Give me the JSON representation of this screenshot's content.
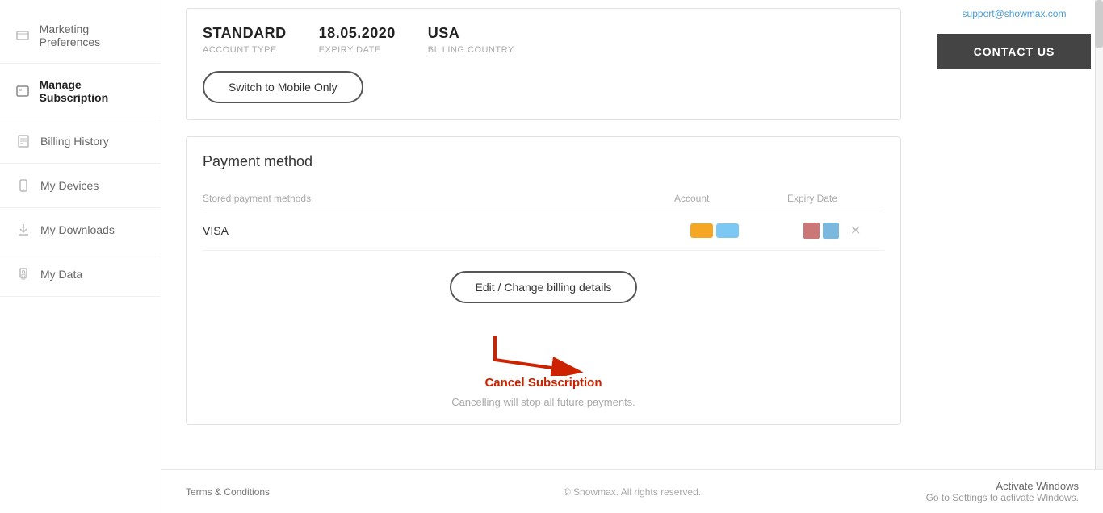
{
  "sidebar": {
    "items": [
      {
        "id": "marketing-preferences",
        "label": "Marketing Preferences",
        "icon": "☰",
        "active": false
      },
      {
        "id": "manage-subscription",
        "label": "Manage Subscription",
        "icon": "▭",
        "active": true
      },
      {
        "id": "billing-history",
        "label": "Billing History",
        "icon": "▦",
        "active": false
      },
      {
        "id": "my-devices",
        "label": "My Devices",
        "icon": "📱",
        "active": false
      },
      {
        "id": "my-downloads",
        "label": "My Downloads",
        "icon": "⬇",
        "active": false
      },
      {
        "id": "my-data",
        "label": "My Data",
        "icon": "🔒",
        "active": false
      }
    ]
  },
  "subscription": {
    "account_type": "STANDARD",
    "account_type_label": "ACCOUNT TYPE",
    "expiry_date": "18.05.2020",
    "expiry_date_label": "EXPIRY DATE",
    "billing_country": "USA",
    "billing_country_label": "BILLING COUNTRY",
    "switch_button_label": "Switch to Mobile Only"
  },
  "payment": {
    "section_title": "Payment method",
    "headers": {
      "col1": "Stored payment methods",
      "col2": "Account",
      "col3": "Expiry Date"
    },
    "rows": [
      {
        "method": "VISA",
        "account_color1": "#f5a623",
        "account_color2": "#7bc8f5",
        "expiry_color1": "#cc7777",
        "expiry_color2": "#7ab8dd"
      }
    ],
    "edit_button_label": "Edit / Change billing details",
    "cancel_link_label": "Cancel Subscription",
    "cancel_note": "Cancelling will stop all future payments."
  },
  "contact": {
    "email": "support@showmax.com",
    "button_label": "CONTACT US"
  },
  "footer": {
    "terms_label": "Terms & Conditions",
    "copyright": "© Showmax. All rights reserved.",
    "activate_windows_title": "Activate Windows",
    "activate_windows_note": "Go to Settings to activate Windows."
  }
}
